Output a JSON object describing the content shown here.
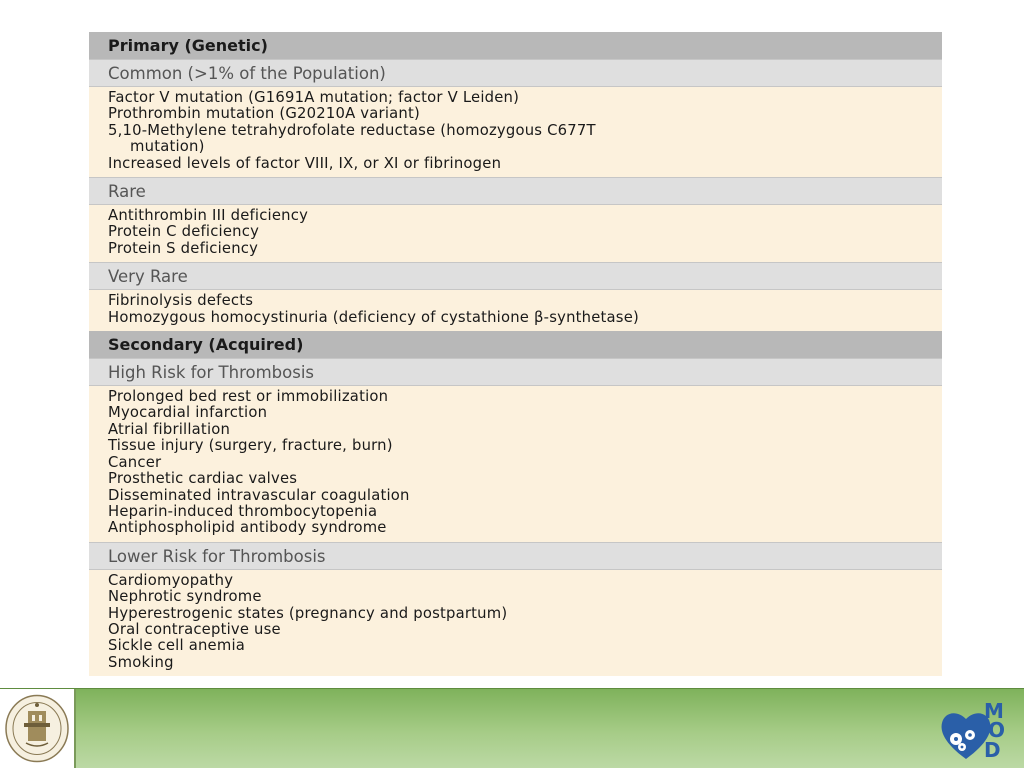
{
  "table": {
    "sections": [
      {
        "title": "Primary (Genetic)",
        "groups": [
          {
            "title": "Common (>1% of the Population)",
            "items": [
              {
                "text": "Factor V mutation (G1691A mutation; factor V Leiden)"
              },
              {
                "text": "Prothrombin mutation (G20210A variant)"
              },
              {
                "text": "5,10-Methylene tetrahydrofolate reductase (homozygous C677T"
              },
              {
                "text": "mutation)",
                "cont": true
              },
              {
                "text": "Increased levels of factor VIII, IX, or XI or fibrinogen"
              }
            ]
          },
          {
            "title": "Rare",
            "items": [
              {
                "text": "Antithrombin III deficiency"
              },
              {
                "text": "Protein C deficiency"
              },
              {
                "text": "Protein S deficiency"
              }
            ]
          },
          {
            "title": "Very Rare",
            "items": [
              {
                "text": "Fibrinolysis defects"
              },
              {
                "text": "Homozygous homocystinuria (deficiency of cystathione β-synthetase)"
              }
            ]
          }
        ]
      },
      {
        "title": "Secondary (Acquired)",
        "groups": [
          {
            "title": "High Risk for Thrombosis",
            "items": [
              {
                "text": "Prolonged bed rest or immobilization"
              },
              {
                "text": "Myocardial infarction"
              },
              {
                "text": "Atrial fibrillation"
              },
              {
                "text": "Tissue injury (surgery, fracture, burn)"
              },
              {
                "text": "Cancer"
              },
              {
                "text": "Prosthetic cardiac valves"
              },
              {
                "text": "Disseminated intravascular coagulation"
              },
              {
                "text": "Heparin-induced thrombocytopenia"
              },
              {
                "text": "Antiphospholipid antibody syndrome"
              }
            ]
          },
          {
            "title": "Lower Risk for Thrombosis",
            "items": [
              {
                "text": "Cardiomyopathy"
              },
              {
                "text": "Nephrotic syndrome"
              },
              {
                "text": "Hyperestrogenic states (pregnancy and postpartum)"
              },
              {
                "text": "Oral contraceptive use"
              },
              {
                "text": "Sickle cell anemia"
              },
              {
                "text": "Smoking"
              }
            ]
          }
        ]
      }
    ]
  },
  "footer": {
    "background_color": "#9cc47c",
    "logo_letters": [
      "M",
      "O",
      "D"
    ],
    "logo_colors": {
      "heart": "#2a5fa8",
      "letters": "#2a5fa8",
      "gears": "#ffffff"
    }
  }
}
